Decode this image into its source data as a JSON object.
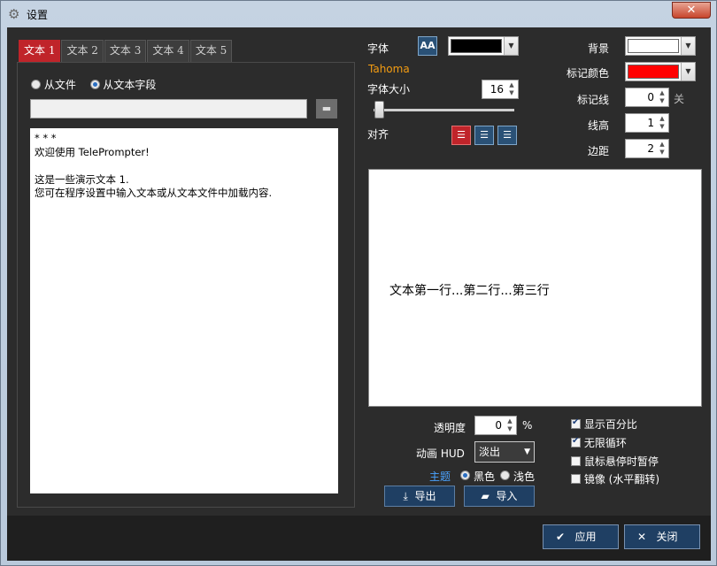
{
  "window": {
    "title": "设置",
    "close_symbol": "✕"
  },
  "tabs": [
    {
      "label": "文本 1",
      "active": true
    },
    {
      "label": "文本 2",
      "active": false
    },
    {
      "label": "文本 3",
      "active": false
    },
    {
      "label": "文本 4",
      "active": false
    },
    {
      "label": "文本 5",
      "active": false
    }
  ],
  "source": {
    "from_file": "从文件",
    "from_text": "从文本字段",
    "selected": "from_text"
  },
  "text_content": "* * *\n欢迎使用 TelePrompter!\n\n这是一些演示文本 1.\n您可在程序设置中输入文本或从文本文件中加载内容.",
  "font": {
    "label": "字体",
    "name": "Tahoma",
    "name_color": "#f39c12",
    "color": "#000000",
    "size_label": "字体大小",
    "size": "16",
    "align_label": "对齐",
    "align_selected": "left"
  },
  "right_settings": {
    "background_label": "背景",
    "background_color": "#ffffff",
    "marker_color_label": "标记颜色",
    "marker_color": "#ff0000",
    "marker_line_label": "标记线",
    "marker_line_value": "0",
    "marker_line_state": "关",
    "line_height_label": "线高",
    "line_height_value": "1",
    "margin_label": "边距",
    "margin_value": "2"
  },
  "preview": {
    "text": "文本第一行...第二行...第三行"
  },
  "bottom": {
    "opacity_label": "透明度",
    "opacity_value": "0",
    "opacity_unit": "%",
    "hud_label": "动画 HUD",
    "hud_value": "淡出",
    "theme_label": "主题",
    "theme_dark": "黑色",
    "theme_light": "浅色",
    "theme_selected": "dark",
    "theme_label_color": "#4aa3ff",
    "export_label": "导出",
    "import_label": "导入"
  },
  "checkboxes": [
    {
      "label": "显示百分比",
      "checked": true
    },
    {
      "label": "无限循环",
      "checked": true
    },
    {
      "label": "鼠标悬停时暂停",
      "checked": false
    },
    {
      "label": "镜像 (水平翻转)",
      "checked": false
    }
  ],
  "footer": {
    "apply_label": "应用",
    "close_label": "关闭"
  }
}
